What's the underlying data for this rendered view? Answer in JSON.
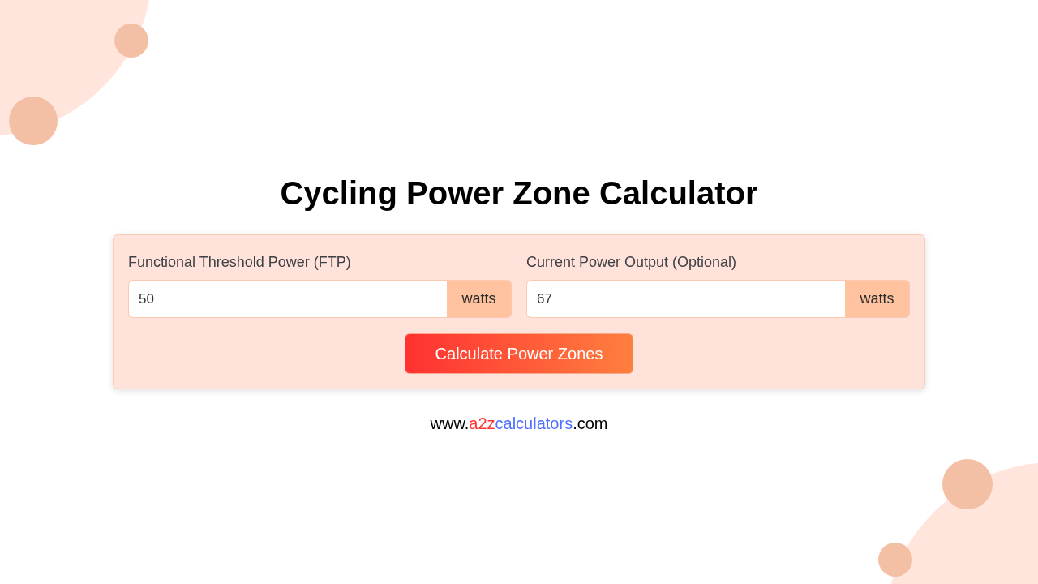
{
  "title": "Cycling Power Zone Calculator",
  "fields": [
    {
      "label": "Functional Threshold Power (FTP)",
      "value": "50",
      "unit": "watts"
    },
    {
      "label": "Current Power Output (Optional)",
      "value": "67",
      "unit": "watts"
    }
  ],
  "button": {
    "label": "Calculate Power Zones"
  },
  "footer": {
    "parts": [
      {
        "text": "www.",
        "color": "#000000"
      },
      {
        "text": "a2z",
        "color": "#ff3131"
      },
      {
        "text": "calculators",
        "color": "#5170ff"
      },
      {
        "text": ".com",
        "color": "#000000"
      }
    ]
  }
}
